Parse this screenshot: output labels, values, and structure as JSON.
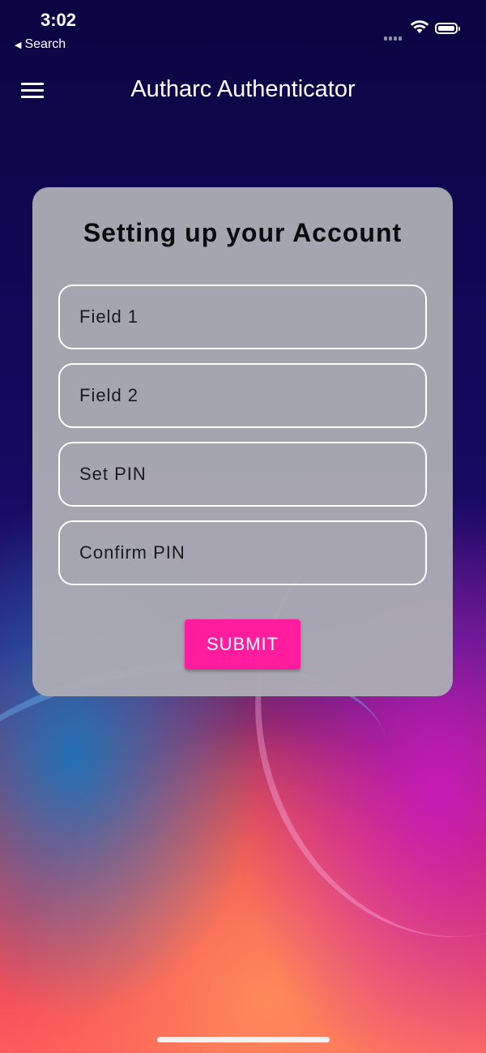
{
  "status_bar": {
    "time": "3:02",
    "back_label": "Search"
  },
  "app_bar": {
    "title": "Autharc Authenticator",
    "menu_icon": "hamburger-menu-icon"
  },
  "form": {
    "title": "Setting up your Account",
    "fields": [
      {
        "placeholder": "Field 1",
        "value": ""
      },
      {
        "placeholder": "Field 2",
        "value": ""
      },
      {
        "placeholder": "Set PIN",
        "value": ""
      },
      {
        "placeholder": "Confirm PIN",
        "value": ""
      }
    ],
    "submit_label": "SUBMIT"
  },
  "colors": {
    "background_top": "#0b0544",
    "card": "#acacb4",
    "submit_button": "#ff1d9e",
    "field_border": "#ffffff"
  }
}
